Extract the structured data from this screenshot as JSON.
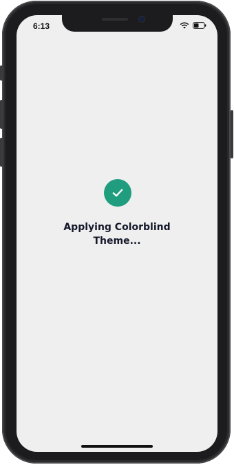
{
  "status_bar": {
    "time": "6:13",
    "icons": [
      "wifi-icon",
      "battery-icon"
    ]
  },
  "main": {
    "icon": "checkmark-icon",
    "message_line1": "Applying Colorblind",
    "message_line2": "Theme..."
  },
  "colors": {
    "accent": "#1f9d7e",
    "background": "#efefef",
    "text": "#15192b"
  }
}
